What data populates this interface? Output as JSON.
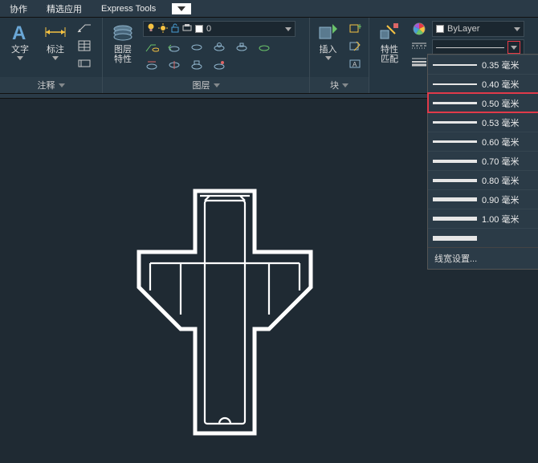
{
  "tabs": {
    "t1": "协作",
    "t2": "精选应用",
    "t3": "Express Tools"
  },
  "annot": {
    "text_label": "文字",
    "dim_label": "标注",
    "panel": "注释"
  },
  "layer": {
    "props_label": "图层\n特性",
    "panel": "图层",
    "current": "0"
  },
  "block": {
    "insert_label": "插入",
    "panel": "块"
  },
  "props": {
    "match_label": "特性\n匹配",
    "bylayer": "ByLayer"
  },
  "lineweights": [
    {
      "w": 2,
      "label": "0.35 毫米"
    },
    {
      "w": 2,
      "label": "0.40 毫米"
    },
    {
      "w": 3,
      "label": "0.50 毫米",
      "selected": true
    },
    {
      "w": 3,
      "label": "0.53 毫米"
    },
    {
      "w": 3,
      "label": "0.60 毫米"
    },
    {
      "w": 4,
      "label": "0.70 毫米"
    },
    {
      "w": 4,
      "label": "0.80 毫米"
    },
    {
      "w": 5,
      "label": "0.90 毫米"
    },
    {
      "w": 5,
      "label": "1.00 毫米"
    },
    {
      "w": 6,
      "label": "",
      "last": true
    }
  ],
  "lw_settings": "线宽设置..."
}
